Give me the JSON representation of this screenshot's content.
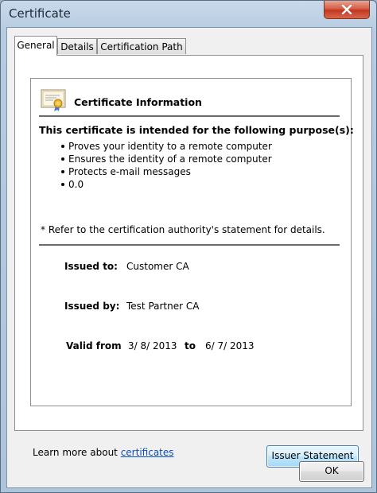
{
  "window": {
    "title": "Certificate",
    "close_icon": "close-icon"
  },
  "tabs": [
    {
      "label": "General",
      "active": true
    },
    {
      "label": "Details",
      "active": false
    },
    {
      "label": "Certification Path",
      "active": false
    }
  ],
  "general": {
    "icon": "certificate-icon",
    "info_title": "Certificate Information",
    "purpose_heading": "This certificate is intended for the following purpose(s):",
    "purposes": [
      "Proves your identity to a remote computer",
      "Ensures the identity of a remote computer",
      "Protects e-mail messages",
      "0.0"
    ],
    "refer_note": "* Refer to the certification authority's statement for details.",
    "issued_to_label": "Issued to:",
    "issued_to_value": "Customer CA",
    "issued_by_label": "Issued by:",
    "issued_by_value": "Test Partner CA",
    "valid_from_label": "Valid from",
    "valid_from_value": "3/ 8/ 2013",
    "valid_to_label": "to",
    "valid_to_value": "6/ 7/ 2013",
    "issuer_statement_button": "Issuer Statement",
    "learn_more_text": "Learn more about ",
    "learn_more_link": "certificates"
  },
  "footer": {
    "ok_button": "OK"
  },
  "colors": {
    "link": "#0b4fbd",
    "close_button": "#c74a33"
  }
}
